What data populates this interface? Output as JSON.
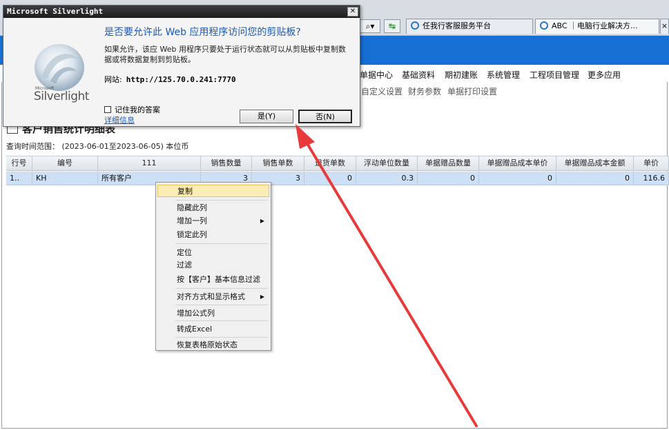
{
  "browser": {
    "search_btn_glyph": "⌕▾",
    "go_btn_glyph": "↹",
    "tabs": [
      {
        "label": "任我行客服服务平台"
      },
      {
        "label": "ABC ｜电脑行业解决方..."
      },
      {
        "label": "×"
      }
    ]
  },
  "menubar": {
    "items": [
      "单据中心",
      "基础资料",
      "期初建账",
      "系统管理",
      "工程项目管理",
      "更多应用"
    ],
    "subitems": [
      "自定义设置",
      "财务参数",
      "单据打印设置"
    ]
  },
  "report": {
    "title": "客户销售统计明细表",
    "query_line": "查询时间范围：  (2023-06-01至2023-06-05) 本位币"
  },
  "grid": {
    "headers": [
      "行号",
      "编号",
      "111",
      "销售数量",
      "销售单数",
      "退货单数",
      "浮动单位数量",
      "单据赠品数量",
      "单据赠品成本单价",
      "单据赠品成本金额",
      "单价"
    ],
    "row": [
      "1..",
      "KH",
      "所有客户",
      "3",
      "3",
      "0",
      "0.3",
      "0",
      "0",
      "0",
      "116.6"
    ]
  },
  "context_menu": {
    "items": [
      "复制",
      "隐藏此列",
      "增加一列",
      "锁定此列",
      "定位",
      "过滤",
      "按【客户】基本信息过滤",
      "对齐方式和显示格式",
      "增加公式列",
      "转成Excel",
      "恢复表格原始状态"
    ]
  },
  "dialog": {
    "title": "Microsoft Silverlight",
    "close_glyph": "✕",
    "question": "是否要允许此 Web 应用程序访问您的剪贴板?",
    "description": "如果允许，该应 Web 用程序只要处于运行状态就可以从剪贴板中复制数据或将数据复制到剪贴板。",
    "site_label": "网站:",
    "site_url": "http://125.70.0.241:7770",
    "remember_label": "记住我的答案",
    "details_link": "详细信息",
    "yes_button": "是(Y)",
    "no_button": "否(N)",
    "logo_small": "Microsoft",
    "logo_text": "Silverlight"
  },
  "colors": {
    "banner": "#1670d4",
    "selected_row": "#cde0f5",
    "menu_highlight": "#fbedb5",
    "annotation_arrow": "#e8393b"
  }
}
